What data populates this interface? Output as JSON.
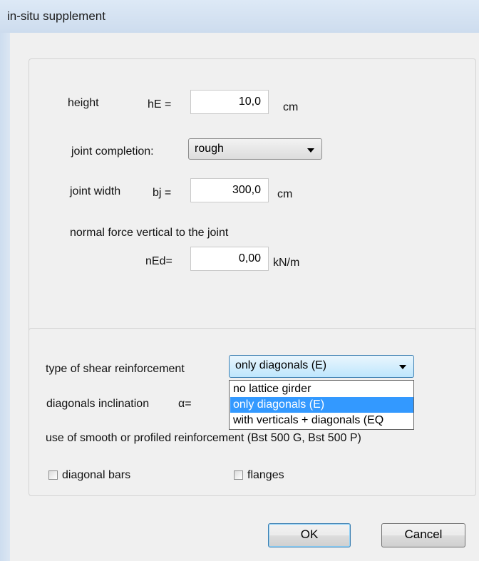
{
  "window": {
    "title": "in-situ supplement"
  },
  "joint_panel": {
    "height_label": "height",
    "he_label": "hE =",
    "he_value": "10,0",
    "he_unit": "cm",
    "joint_completion_label": "joint completion:",
    "joint_completion_value": "rough",
    "joint_width_label": "joint width",
    "bj_label": "bj  =",
    "bj_value": "300,0",
    "bj_unit": "cm",
    "normal_force_label": "normal force vertical to the joint",
    "ned_label": "nEd=",
    "ned_value": "0,00",
    "ned_unit": "kN/m"
  },
  "reinforcement_panel": {
    "shear_type_label": "type of shear reinforcement",
    "shear_type_value": "only diagonals (E)",
    "shear_type_options": [
      "no  lattice girder",
      "only diagonals (E)",
      "with verticals + diagonals (EQ"
    ],
    "shear_type_selected_index": 1,
    "inclination_label": "diagonals inclination",
    "alpha_label": "α=",
    "smooth_profiled_label": "use of smooth or profiled reinforcement (Bst 500 G, Bst 500 P)",
    "diagonal_bars_label": "diagonal bars",
    "diagonal_bars_checked": false,
    "flanges_label": "flanges",
    "flanges_checked": false
  },
  "buttons": {
    "ok_label": "OK",
    "cancel_label": "Cancel"
  }
}
